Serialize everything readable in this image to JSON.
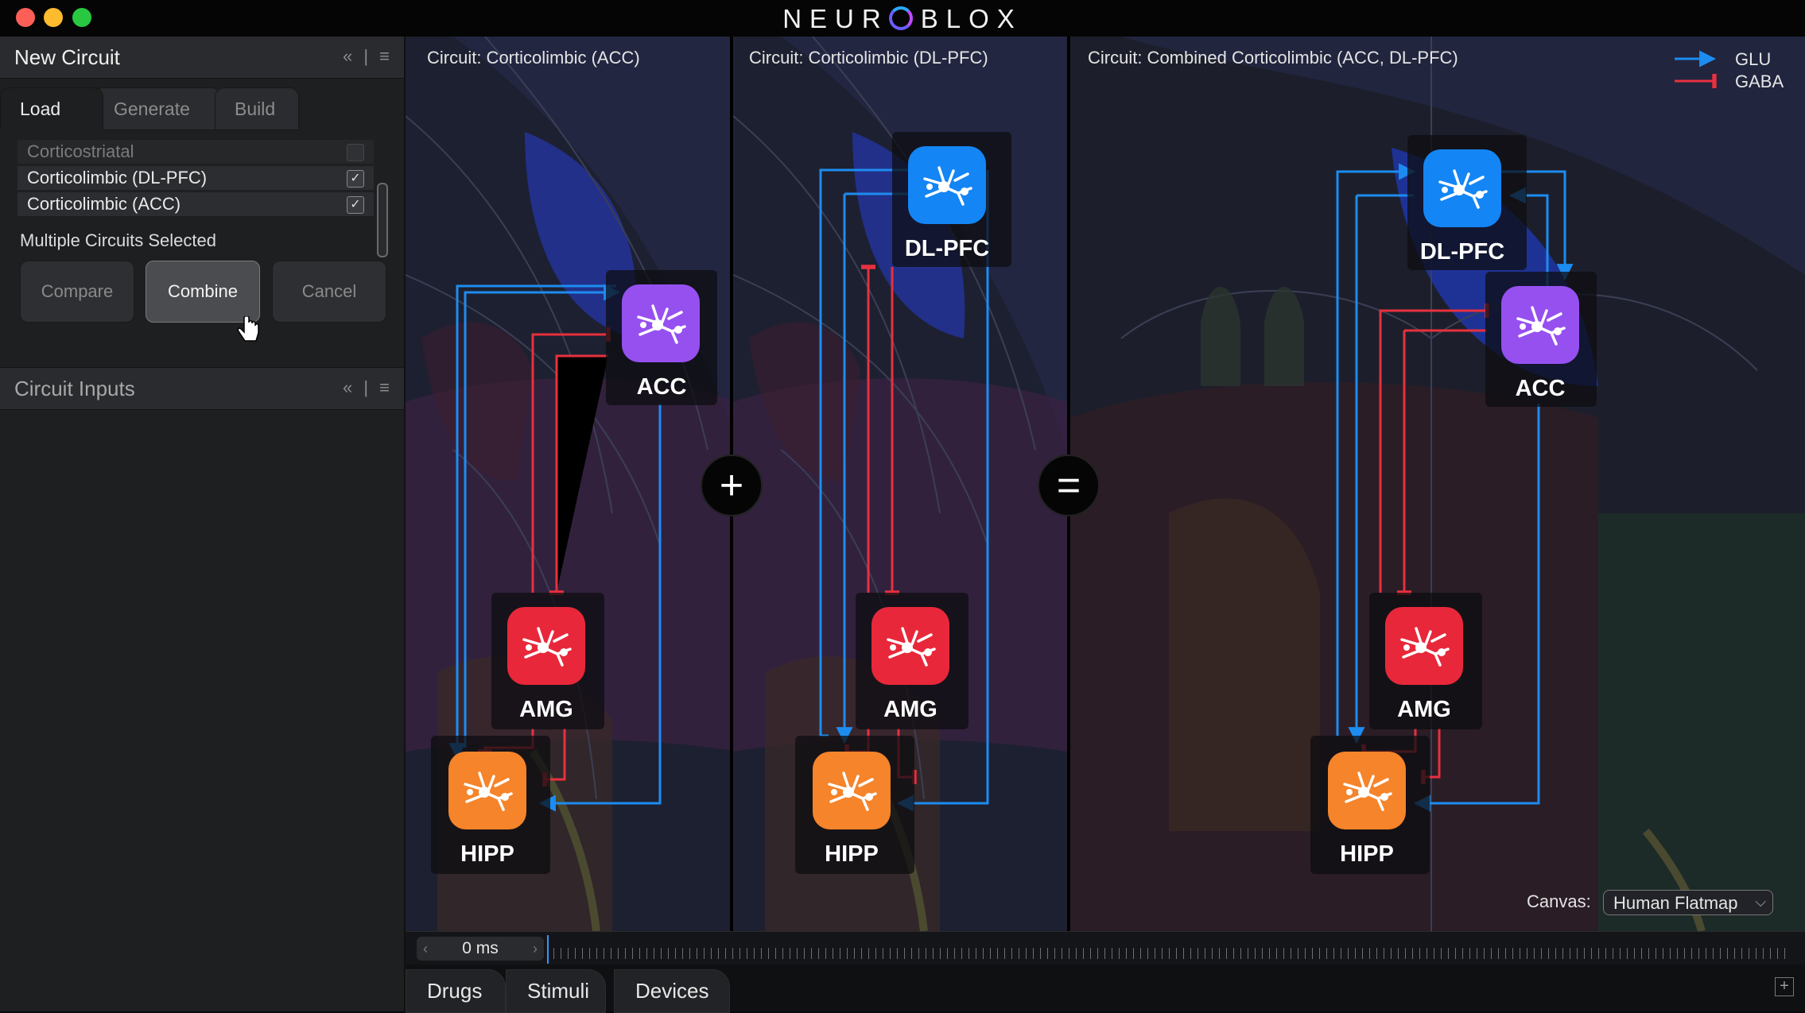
{
  "window": {
    "title_pre": "NEUR",
    "title_post": "BLOX",
    "title_colors": {
      "red": "#fd5f57",
      "yellow": "#febb2e",
      "green": "#28c840"
    }
  },
  "left_panel": {
    "new_circuit": {
      "title": "New Circuit",
      "controls": "« | ≡",
      "tabs": [
        "Load",
        "Generate",
        "Build"
      ],
      "circuits": [
        {
          "name": "Corticostriatal",
          "checked": false
        },
        {
          "name": "Corticolimbic (DL-PFC)",
          "checked": true
        },
        {
          "name": "Corticolimbic (ACC)",
          "checked": true
        }
      ],
      "check_glyph": "✓",
      "status": "Multiple Circuits Selected",
      "buttons": {
        "compare": "Compare",
        "combine": "Combine",
        "cancel": "Cancel"
      }
    },
    "circuit_inputs": {
      "title": "Circuit Inputs",
      "controls": "« | ≡"
    }
  },
  "canvas": {
    "panels": [
      "Circuit: Corticolimbic (ACC)",
      "Circuit: Corticolimbic (DL-PFC)",
      "Circuit: Combined Corticolimbic (ACC, DL-PFC)"
    ],
    "operators": {
      "plus": "+",
      "equals": "="
    },
    "legend": [
      {
        "label": "GLU",
        "color": "#1d8cf0"
      },
      {
        "label": "GABA",
        "color": "#e8303e"
      }
    ],
    "nodes": {
      "acc": {
        "label": "ACC",
        "color": "#9650f0"
      },
      "dlpfc": {
        "label": "DL-PFC",
        "color": "#1485f5"
      },
      "amg": {
        "label": "AMG",
        "color": "#e8283a"
      },
      "hipp": {
        "label": "HIPP",
        "color": "#f5842a"
      }
    },
    "canvas_label": "Canvas:",
    "canvas_value": "Human Flatmap"
  },
  "timeline": {
    "time": "0 ms",
    "prev": "‹",
    "next": "›"
  },
  "bottom_tabs": [
    "Drugs",
    "Stimuli",
    "Devices"
  ],
  "bottom_plus": "+"
}
